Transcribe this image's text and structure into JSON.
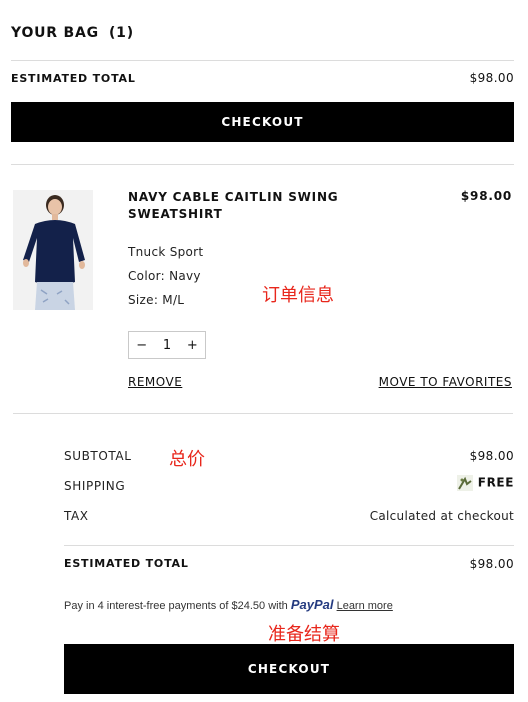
{
  "bag": {
    "title": "YOUR BAG",
    "count": "(1)"
  },
  "top": {
    "estimated_label": "ESTIMATED TOTAL",
    "estimated_value": "$98.00",
    "checkout_label": "CHECKOUT"
  },
  "item": {
    "name": "NAVY CABLE CAITLIN SWING SWEATSHIRT",
    "price": "$98.00",
    "brand": "Tnuck Sport",
    "color": "Color: Navy",
    "size": "Size: M/L",
    "qty": "1",
    "remove_label": "REMOVE",
    "favorites_label": "MOVE TO FAVORITES"
  },
  "summary": {
    "subtotal_label": "SUBTOTAL",
    "subtotal_value": "$98.00",
    "shipping_label": "SHIPPING",
    "shipping_value": "FREE",
    "tax_label": "TAX",
    "tax_value": "Calculated at checkout",
    "estimated_label": "ESTIMATED TOTAL",
    "estimated_value": "$98.00"
  },
  "paypal": {
    "prefix": "Pay in 4 interest-free payments of $24.50 with",
    "brand": "PayPal",
    "learn": "Learn more"
  },
  "bottom": {
    "checkout_label": "CHECKOUT"
  },
  "annotations": {
    "order_info": "订单信息",
    "total": "总价",
    "ready": "准备结算"
  },
  "colors": {
    "accent": "#000000",
    "annotation": "#e8271c",
    "paypal": "#253b80"
  }
}
